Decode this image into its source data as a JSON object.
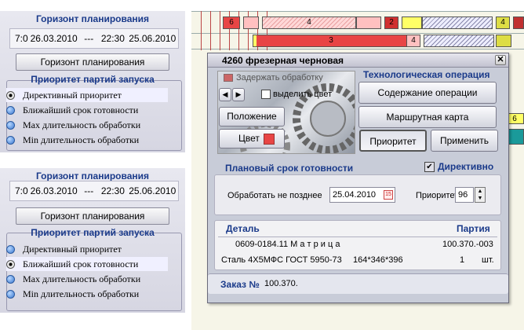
{
  "horizon_panels": [
    {
      "title": "Горизонт планирования",
      "from_time": "7:0",
      "from_date": "26.03.2010",
      "separator": "---",
      "to_time": "22:30",
      "to_date": "25.06.2010",
      "button": "Горизонт планирования",
      "priority_title": "Приоритет партий запуска",
      "options": [
        "Директивный приоритет",
        "Ближайший срок готовности",
        "Max длительность обработки",
        "Min длительность обработки"
      ],
      "selected": 0
    },
    {
      "title": "Горизонт планирования",
      "from_time": "7:0",
      "from_date": "26.03.2010",
      "separator": "---",
      "to_time": "22:30",
      "to_date": "25.06.2010",
      "button": "Горизонт планирования",
      "priority_title": "Приоритет партий запуска",
      "options": [
        "Директивный приоритет",
        "Ближайший срок готовности",
        "Max длительность обработки",
        "Min длительность обработки"
      ],
      "selected": 1
    }
  ],
  "gantt": {
    "labels": [
      "6",
      "4",
      "2",
      "4",
      "3",
      "4",
      "6"
    ]
  },
  "dialog": {
    "title": "4260 фрезерная черновая",
    "hold": "Задержать обработку",
    "highlight": "выделить цвет",
    "position_btn": "Положение",
    "color_btn": "Цвет",
    "tech_op": "Технологическая операция",
    "op_content": "Содержание операции",
    "route_card": "Маршрутная карта",
    "priority_btn": "Приоритет",
    "apply_btn": "Применить",
    "planned_title": "Плановый срок готовности",
    "directive": "Директивно",
    "process_by_label": "Обработать не позднее",
    "process_by_value": "25.04.2010",
    "priority_label": "Приоритет",
    "priority_value": "96",
    "detail_hdr": "Деталь",
    "batch_hdr": "Партия",
    "detail_name": "0609-0184.11 М а т р и ц а",
    "batch_code": "100.370.-003",
    "material": "Сталь 4Х5МФС ГОСТ 5950-73",
    "dims": "164*346*396",
    "qty": "1",
    "unit": "шт.",
    "order_label": "Заказ №",
    "order_value": "100.370."
  },
  "colors": {
    "red": "#e84545",
    "yellow": "#ffff66",
    "blue_title": "#1a3a8a",
    "teal": "#1a9a9a"
  }
}
